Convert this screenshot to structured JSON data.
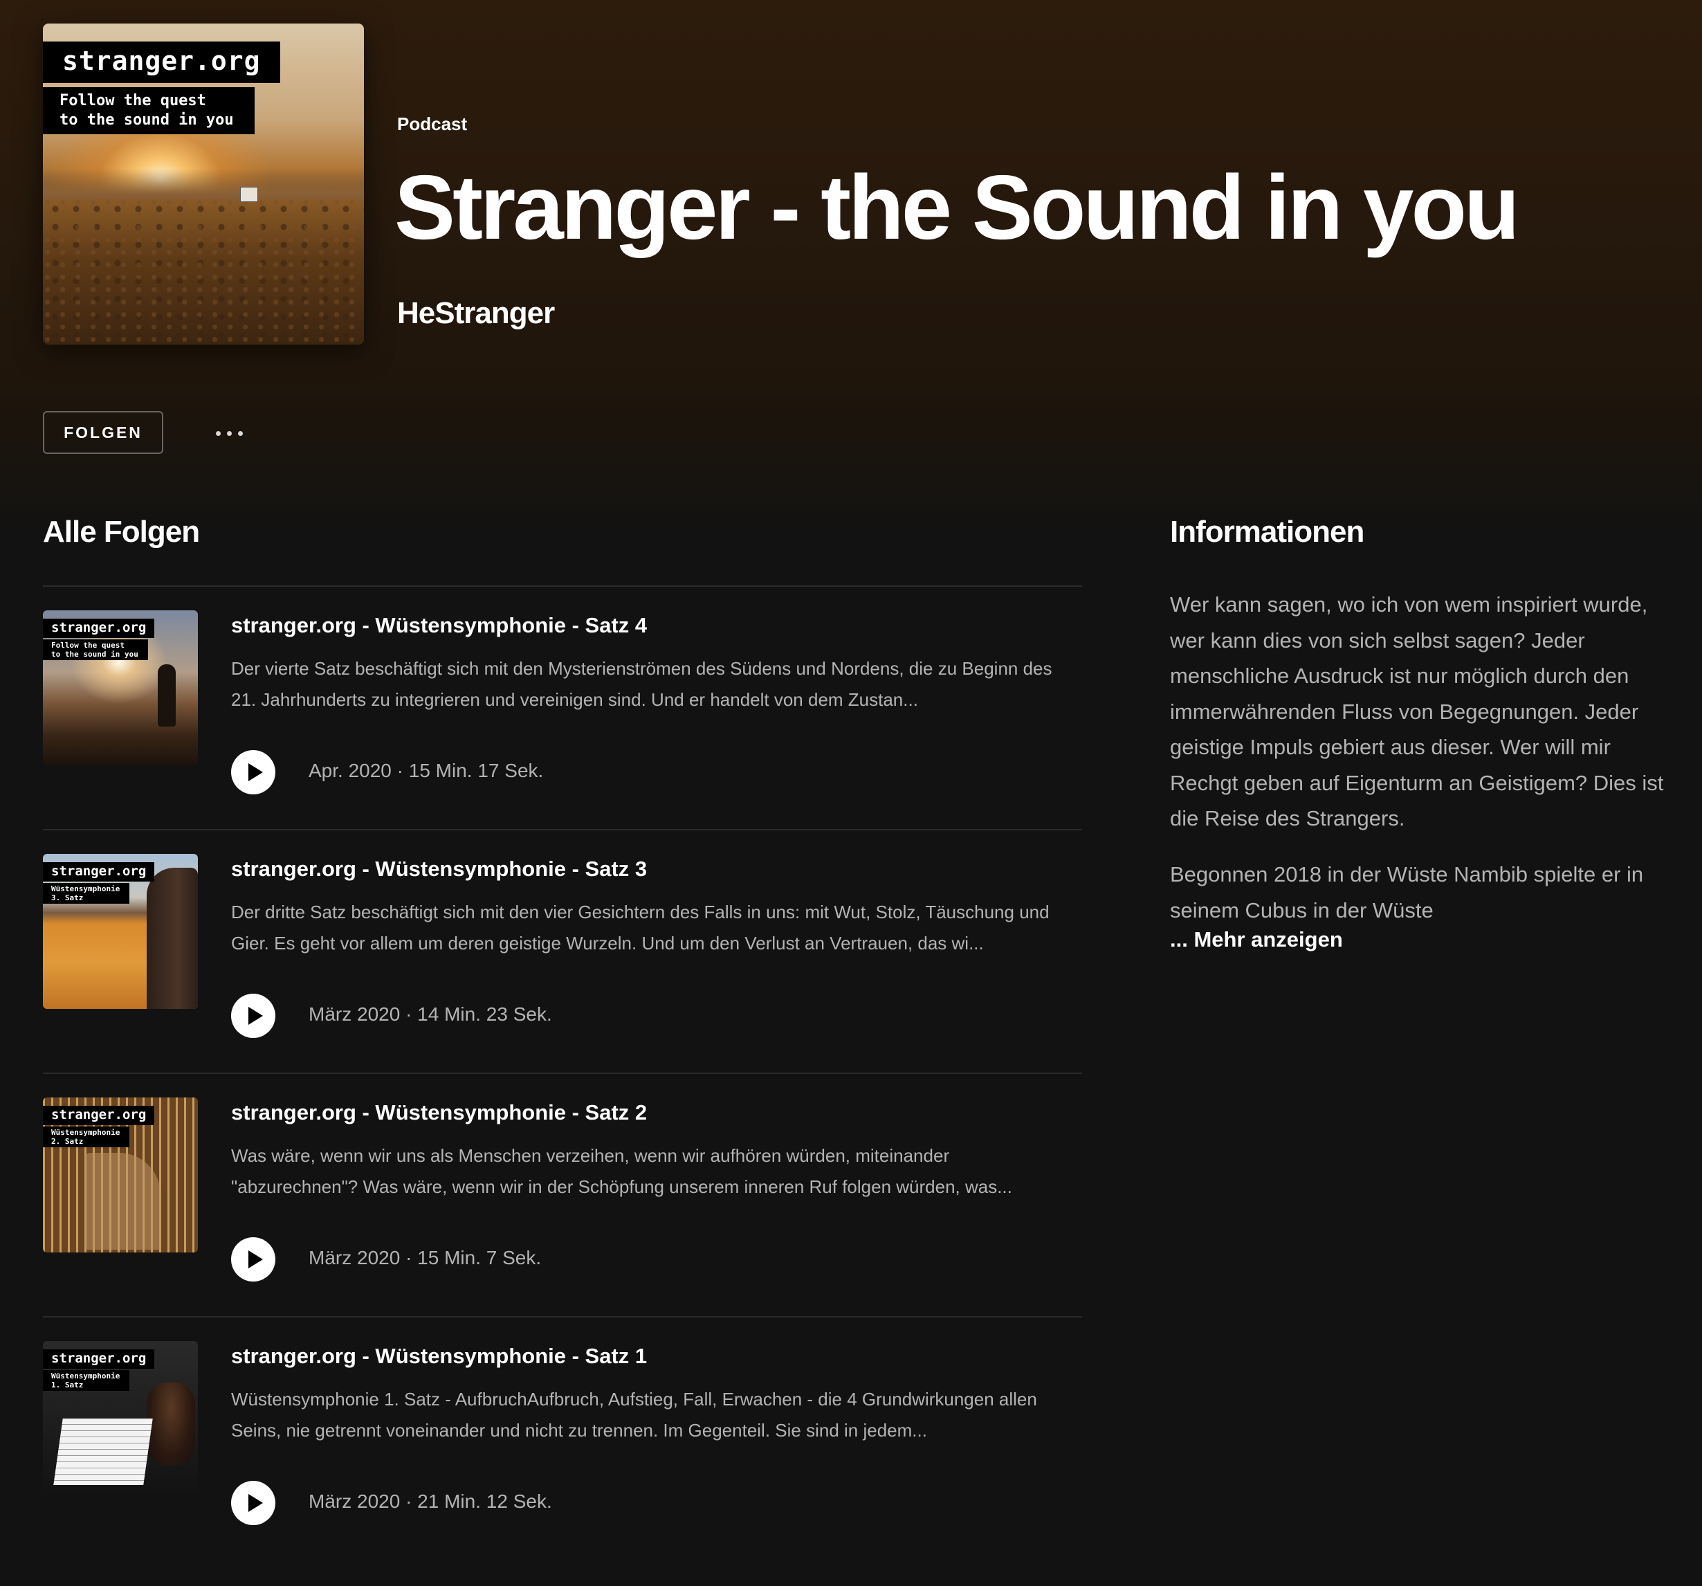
{
  "podcast": {
    "kind": "Podcast",
    "title": "Stranger - the Sound in you",
    "author": "HeStranger",
    "cover": {
      "brand": "stranger.org",
      "tagline": "Follow the quest\nto the sound in you"
    }
  },
  "actions": {
    "follow_label": "FOLGEN",
    "more_icon": "ellipsis-icon"
  },
  "episodes_section": {
    "title": "Alle Folgen",
    "items": [
      {
        "title": "stranger.org - Wüstensymphonie - Satz 4",
        "description": "Der vierte Satz beschäftigt sich mit den Mysterienströmen des Südens und Nordens, die zu Beginn des 21. Jahrhunderts zu integrieren und vereinigen sind. Und er handelt von dem Zustan...",
        "meta": "Apr. 2020 · 15 Min. 17 Sek.",
        "thumb_brand": "stranger.org",
        "thumb_caption": "Follow the quest\nto the sound in you"
      },
      {
        "title": "stranger.org - Wüstensymphonie - Satz 3",
        "description": "Der dritte Satz beschäftigt sich mit den vier Gesichtern des Falls in uns: mit Wut, Stolz, Täuschung und Gier. Es geht vor allem um deren geistige Wurzeln. Und um den Verlust an Vertrauen, das wi...",
        "meta": "März 2020 · 14 Min. 23 Sek.",
        "thumb_brand": "stranger.org",
        "thumb_caption": "Wüstensymphonie\n3. Satz"
      },
      {
        "title": "stranger.org - Wüstensymphonie - Satz 2",
        "description": "Was wäre, wenn wir uns als Menschen verzeihen, wenn wir aufhören würden, miteinander \"abzurechnen\"? Was wäre, wenn wir in der Schöpfung unserem inneren Ruf folgen würden, was...",
        "meta": "März 2020 · 15 Min. 7 Sek.",
        "thumb_brand": "stranger.org",
        "thumb_caption": "Wüstensymphonie\n2. Satz"
      },
      {
        "title": "stranger.org - Wüstensymphonie - Satz 1",
        "description": "Wüstensymphonie 1. Satz - AufbruchAufbruch, Aufstieg, Fall, Erwachen - die 4 Grundwirkungen allen Seins, nie getrennt voneinander und nicht zu trennen. Im Gegenteil. Sie sind in jedem...",
        "meta": "März 2020 · 21 Min. 12 Sek.",
        "thumb_brand": "stranger.org",
        "thumb_caption": "Wüstensymphonie\n1. Satz"
      }
    ]
  },
  "info_section": {
    "title": "Informationen",
    "paragraph1": "Wer kann sagen, wo ich von wem inspiriert wurde, wer kann dies von sich selbst sagen? Jeder menschliche Ausdruck ist nur möglich durch den immerwährenden Fluss von Begegnungen. Jeder geistige Impuls gebiert aus dieser. Wer will mir Rechgt geben auf Eigenturm an Geistigem? Dies ist die Reise des Strangers.",
    "paragraph2": "Begonnen 2018 in der Wüste Nambib spielte er in seinem Cubus in der Wüste",
    "more_label": "... Mehr anzeigen"
  },
  "colors": {
    "background": "#121212",
    "header_gradient_top": "#2d1c0c",
    "text_primary": "#ffffff",
    "text_secondary": "#b3b3b3",
    "divider": "#2a2a2a"
  },
  "icons": {
    "play": "play-icon",
    "more": "ellipsis-icon"
  }
}
